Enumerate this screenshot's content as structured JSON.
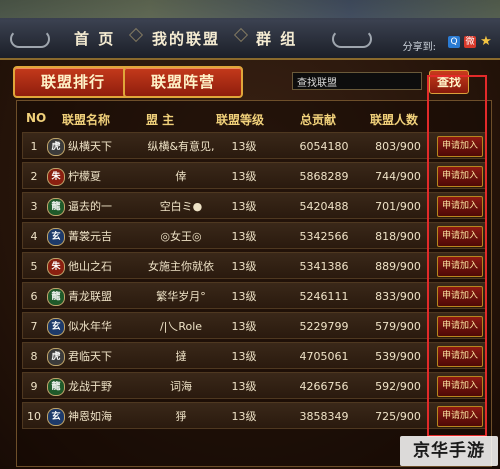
{
  "nav": {
    "items": [
      "首 页",
      "我的联盟",
      "群 组"
    ],
    "share_label": "分享到:"
  },
  "tabs": {
    "rank": "联盟排行",
    "camp": "联盟阵营"
  },
  "search": {
    "value": "查找联盟",
    "button": "查找"
  },
  "table": {
    "headers": [
      "NO",
      "联盟名称",
      "盟 主",
      "联盟等级",
      "总贡献",
      "联盟人数"
    ],
    "apply_label": "申请加入",
    "rows": [
      {
        "no": "1",
        "badge": "虎",
        "badge_color": "#3b3b3b",
        "name": "纵横天下",
        "leader": "纵横&有意见,",
        "level": "13级",
        "contrib": "6054180",
        "members": "803/900"
      },
      {
        "no": "2",
        "badge": "朱",
        "badge_color": "#8a1f10",
        "name": "柠檬夏",
        "leader": "倖",
        "level": "13级",
        "contrib": "5868289",
        "members": "744/900"
      },
      {
        "no": "3",
        "badge": "龍",
        "badge_color": "#1f5a2a",
        "name": "逼去的一",
        "leader": "空白ミ●",
        "level": "13级",
        "contrib": "5420488",
        "members": "701/900"
      },
      {
        "no": "4",
        "badge": "玄",
        "badge_color": "#1d3a6a",
        "name": "菁裳元吉",
        "leader": "◎女王◎",
        "level": "13级",
        "contrib": "5342566",
        "members": "818/900"
      },
      {
        "no": "5",
        "badge": "朱",
        "badge_color": "#8a1f10",
        "name": "他山之石",
        "leader": "女施主你就依",
        "level": "13级",
        "contrib": "5341386",
        "members": "889/900"
      },
      {
        "no": "6",
        "badge": "龍",
        "badge_color": "#1f5a2a",
        "name": "青龙联盟",
        "leader": "繁华岁月°",
        "level": "13级",
        "contrib": "5246111",
        "members": "833/900"
      },
      {
        "no": "7",
        "badge": "玄",
        "badge_color": "#1d3a6a",
        "name": "似水年华",
        "leader": "/|乀Role",
        "level": "13级",
        "contrib": "5229799",
        "members": "579/900"
      },
      {
        "no": "8",
        "badge": "虎",
        "badge_color": "#3b3b3b",
        "name": "君临天下",
        "leader": "撻",
        "level": "13级",
        "contrib": "4705061",
        "members": "539/900"
      },
      {
        "no": "9",
        "badge": "龍",
        "badge_color": "#1f5a2a",
        "name": "龙战于野",
        "leader": "词海",
        "level": "13级",
        "contrib": "4266756",
        "members": "592/900"
      },
      {
        "no": "10",
        "badge": "玄",
        "badge_color": "#1d3a6a",
        "name": "神恩如海",
        "leader": "猙",
        "level": "13级",
        "contrib": "3858349",
        "members": "725/900"
      }
    ]
  },
  "watermark": "京华手游"
}
